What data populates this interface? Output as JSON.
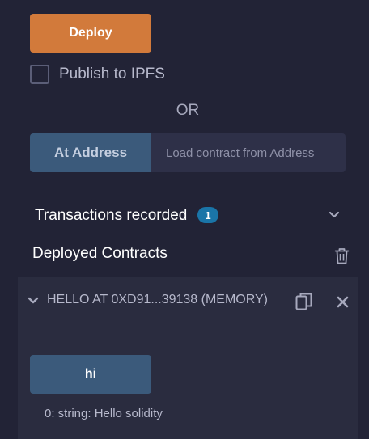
{
  "deploy": {
    "button_label": "Deploy",
    "publish_label": "Publish to IPFS",
    "publish_checked": false
  },
  "divider": {
    "or_text": "OR"
  },
  "at_address": {
    "button_label": "At Address",
    "placeholder": "Load contract from Address"
  },
  "transactions": {
    "label": "Transactions recorded",
    "count": "1",
    "icon": "chevron-down-icon"
  },
  "deployed": {
    "title": "Deployed Contracts",
    "icon": "trash-icon"
  },
  "contract": {
    "title": "HELLO AT 0XD91...39138 (MEMORY)",
    "function_button": "hi",
    "result_index": "0:",
    "result_text": " string: Hello solidity"
  },
  "colors": {
    "deploy_accent": "#d27a3b",
    "secondary_button": "#3b5a7b",
    "badge": "#1a75a8",
    "background": "#222336",
    "card": "#2a2c3f"
  }
}
